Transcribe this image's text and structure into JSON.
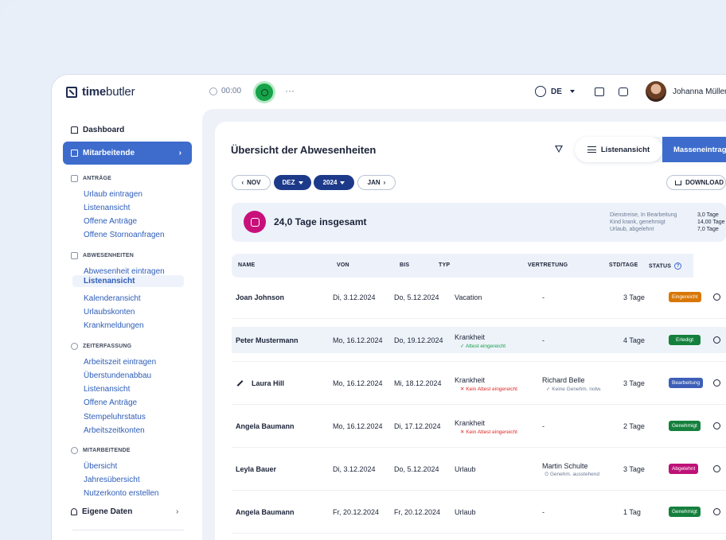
{
  "app": {
    "logo_bold": "time",
    "logo_rest": "butler",
    "timer": "00:00",
    "more": "···",
    "language": "DE",
    "user_name": "Johanna Müller"
  },
  "sidebar": {
    "dashboard": "Dashboard",
    "active_item": "Mitarbeitende",
    "sections": [
      {
        "title": "ANTRÄGE",
        "items": [
          "Urlaub eintragen",
          "Listenansicht",
          "Offene Anträge",
          "Offene Stornoanfragen"
        ]
      },
      {
        "title": "ABWESENHEITEN",
        "items": [
          "Abwesenheit eintragen",
          "Listenansicht",
          "Kalenderansicht",
          "Urlaubskonten",
          "Krankmeldungen"
        ]
      },
      {
        "title": "ZEITERFASSUNG",
        "items": [
          "Arbeitszeit eintragen",
          "Überstundenabbau",
          "Listenansicht",
          "Offene Anträge",
          "Stempeluhrstatus",
          "Arbeitszeitkonten"
        ]
      },
      {
        "title": "MITARBEITENDE",
        "items": [
          "Übersicht",
          "Jahresübersicht",
          "Nutzerkonto erstellen"
        ]
      }
    ],
    "own_data": "Eigene Daten"
  },
  "main": {
    "title": "Übersicht der Abwesenheiten",
    "list_view": "Listenansicht",
    "mass_entry": "Masseneintrag",
    "nav": {
      "prev": "NOV",
      "month": "DEZ",
      "year": "2024",
      "next": "JAN"
    },
    "download": "DOWNLOAD",
    "summary": {
      "total": "24,0 Tage insgesamt",
      "labels": [
        "Dienstreise, In Bearbeitung",
        "Kind krank, genehmigt",
        "Urlaub, abgelehnt"
      ],
      "values": [
        "3,0 Tage",
        "14,00 Tage",
        "7,0 Tage"
      ]
    },
    "columns": [
      "NAME",
      "VON",
      "BIS",
      "TYP",
      "VERTRETUNG",
      "STD/TAGE",
      "STATUS"
    ],
    "rows": [
      {
        "name": "Joan Johnson",
        "von": "Di, 3.12.2024",
        "bis": "Do, 5.12.2024",
        "typ": "Vacation",
        "typ_note": "",
        "vertretung": "-",
        "vertretung_note": "",
        "tage": "3 Tage",
        "status": "Eingereicht"
      },
      {
        "name": "Peter Mustermann",
        "von": "Mo, 16.12.2024",
        "bis": "Do, 19.12.2024",
        "typ": "Krankheit",
        "typ_note": "✓ Attest eingereicht",
        "vertretung": "-",
        "vertretung_note": "",
        "tage": "4 Tage",
        "status": "Erledigt"
      },
      {
        "name": "Laura Hill",
        "von": "Mo, 16.12.2024",
        "bis": "Mi, 18.12.2024",
        "typ": "Krankheit",
        "typ_note": "✕ Kein Attest eingereicht",
        "vertretung": "Richard Belle",
        "vertretung_note": "✓ Keine Genehm. notw.",
        "tage": "3 Tage",
        "status": "Bearbeitung"
      },
      {
        "name": "Angela Baumann",
        "von": "Mo, 16.12.2024",
        "bis": "Di, 17.12.2024",
        "typ": "Krankheit",
        "typ_note": "✕ Kein Attest eingereicht",
        "vertretung": "-",
        "vertretung_note": "",
        "tage": "2 Tage",
        "status": "Genehmigt"
      },
      {
        "name": "Leyla Bauer",
        "von": "Di, 3.12.2024",
        "bis": "Do, 5.12.2024",
        "typ": "Urlaub",
        "typ_note": "",
        "vertretung": "Martin Schulte",
        "vertretung_note": "⏲ Genehm. ausstehend",
        "tage": "3 Tage",
        "status": "Abgelehnt"
      },
      {
        "name": "Angela Baumann",
        "von": "Fr, 20.12.2024",
        "bis": "Fr, 20.12.2024",
        "typ": "Urlaub",
        "typ_note": "",
        "vertretung": "-",
        "vertretung_note": "",
        "tage": "1 Tag",
        "status": "Genehmigt"
      }
    ]
  },
  "colors": {
    "accent": "#3d6ccc",
    "status_eingereicht": "#d97706",
    "status_erledigt": "#15803d",
    "status_bearbeitung": "#3d5fb8",
    "status_genehmigt": "#15803d",
    "status_abgelehnt": "#be1278"
  }
}
